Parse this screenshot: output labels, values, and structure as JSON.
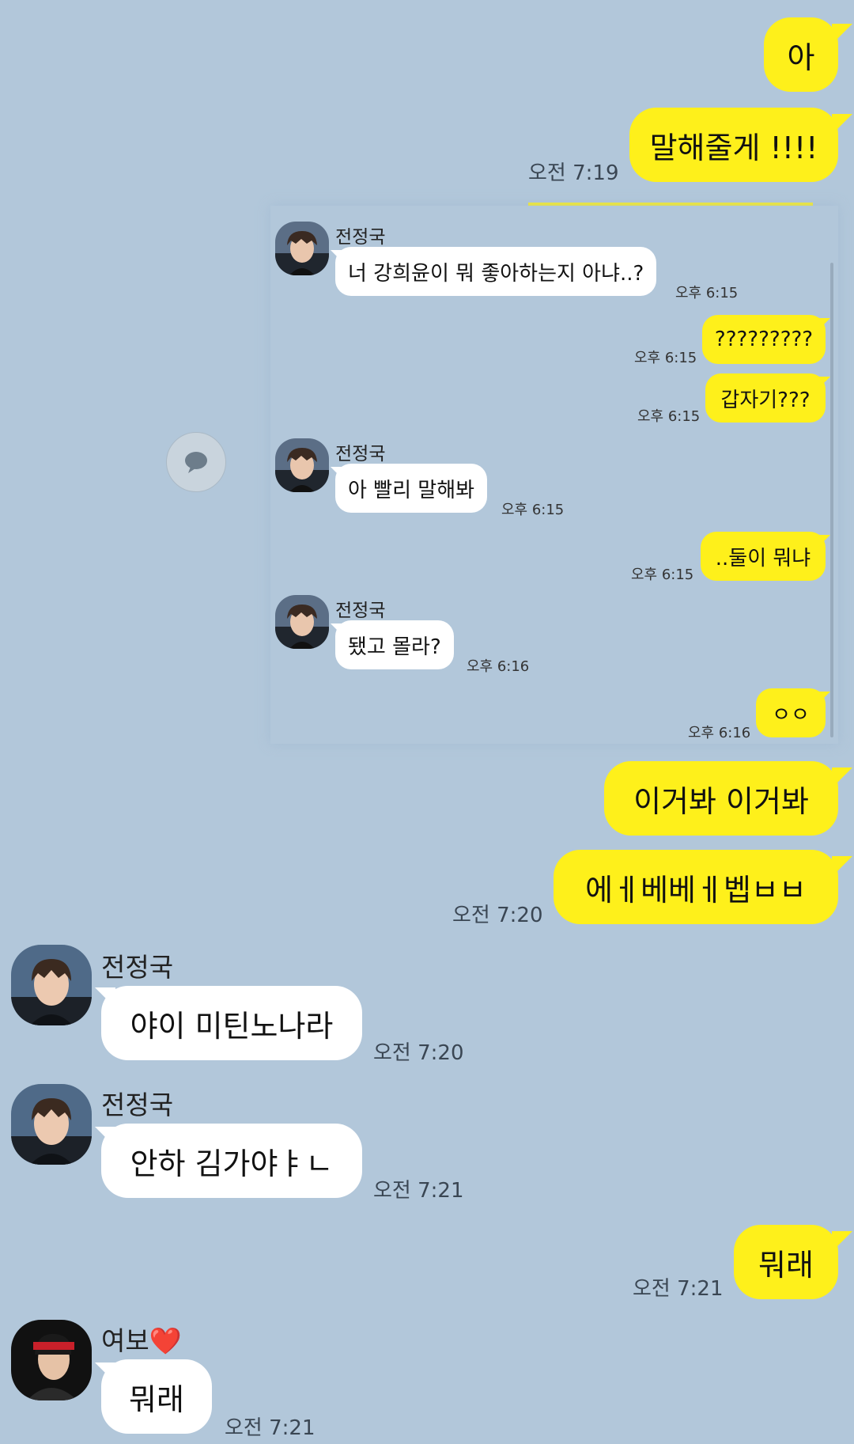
{
  "colors": {
    "background": "#b2c7da",
    "my_bubble": "#fef01b",
    "their_bubble": "#ffffff"
  },
  "outer": {
    "m1": "아",
    "m2": "말해줄게 !!!!",
    "m2_time": "오전 7:19",
    "m3": "이거봐 이거봐",
    "m4": "에ㅔ베베ㅔ벱ㅂㅂ",
    "m4_time": "오전 7:20",
    "r1_name": "전정국",
    "r1_text": "야이 미틴노나라",
    "r1_time": "오전 7:20",
    "r2_name": "전정국",
    "r2_text": "안하 김가야ㅑㄴ",
    "r2_time": "오전 7:21",
    "m5": "뭐래",
    "m5_time": "오전 7:21",
    "r3_name": "여보❤️",
    "r3_text": "뭐래",
    "r3_time": "오전 7:21"
  },
  "inner": {
    "name": "전정국",
    "c1": "너 강희윤이 뭐 좋아하는지 아냐..?",
    "c1_time": "오후 6:15",
    "c2": "?????????",
    "c2_time": "오후 6:15",
    "c3": "갑자기???",
    "c3_time": "오후 6:15",
    "c4": "아 빨리 말해봐",
    "c4_time": "오후 6:15",
    "c5": "..둘이 뭐냐",
    "c5_time": "오후 6:15",
    "c6": "됐고 몰라?",
    "c6_time": "오후 6:16",
    "c7": "ㅇㅇ",
    "c7_time": "오후 6:16"
  },
  "icons": {
    "share": "speech-bubble-icon"
  }
}
